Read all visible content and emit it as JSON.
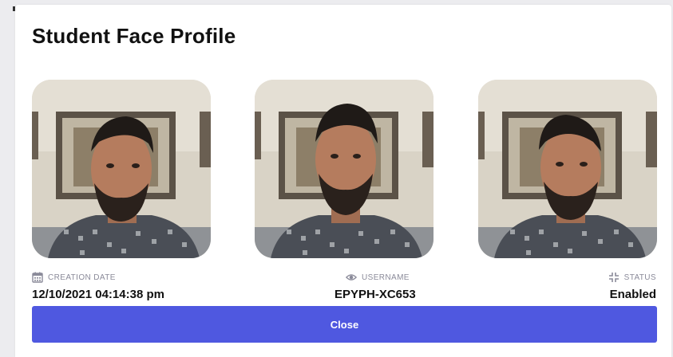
{
  "modal": {
    "title": "Student Face Profile"
  },
  "photos": [
    {
      "icon": "face-photo-left-profile"
    },
    {
      "icon": "face-photo-front"
    },
    {
      "icon": "face-photo-right-profile"
    }
  ],
  "details": {
    "creation_date_label": "CREATION DATE",
    "creation_date_value": "12/10/2021 04:14:38 pm",
    "username_label": "USERNAME",
    "username_value": "EPYPH-XC653",
    "status_label": "STATUS",
    "status_value": "Enabled"
  },
  "actions": {
    "close_label": "Close"
  },
  "colors": {
    "accent": "#4f58e0",
    "label_gray": "#8a8a99",
    "text": "#111111"
  }
}
